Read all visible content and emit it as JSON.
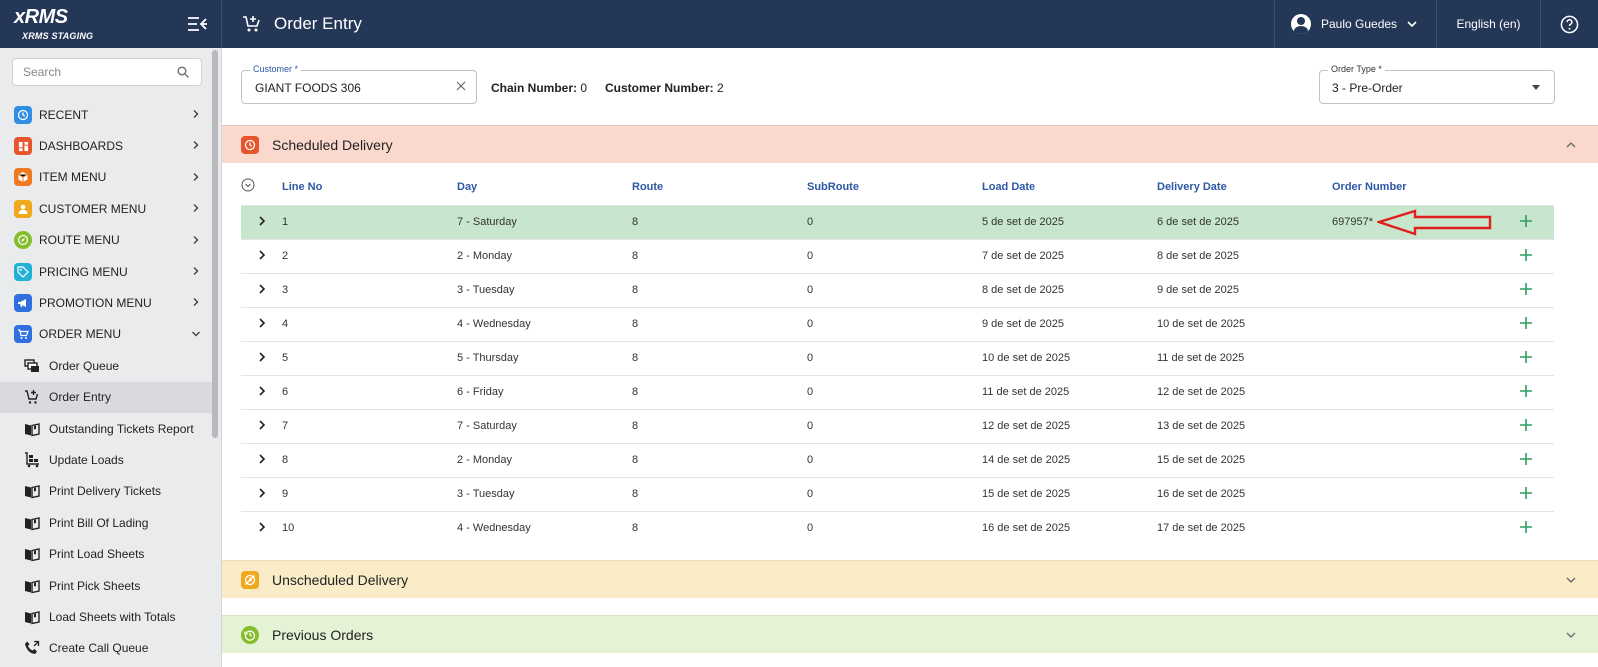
{
  "app": {
    "logo": "xRMS",
    "env": "XRMS STAGING",
    "page_title": "Order Entry",
    "user_name": "Paulo Guedes",
    "language": "English (en)"
  },
  "sidebar": {
    "search_placeholder": "Search",
    "menu": [
      {
        "label": "RECENT",
        "icon": "clock-icon",
        "color": "#2f8fe5"
      },
      {
        "label": "DASHBOARDS",
        "icon": "dashboard-icon",
        "color": "#e8542c"
      },
      {
        "label": "ITEM MENU",
        "icon": "box-icon",
        "color": "#f07a22"
      },
      {
        "label": "CUSTOMER MENU",
        "icon": "person-icon",
        "color": "#f0a81c"
      },
      {
        "label": "ROUTE MENU",
        "icon": "compass-icon",
        "color": "#86bd2c"
      },
      {
        "label": "PRICING MENU",
        "icon": "tag-icon",
        "color": "#21b2d4"
      },
      {
        "label": "PROMOTION MENU",
        "icon": "megaphone-icon",
        "color": "#2f6fe0"
      },
      {
        "label": "ORDER MENU",
        "icon": "cart-icon",
        "color": "#2f6fe0"
      }
    ],
    "submenu": [
      {
        "label": "Order Queue",
        "icon": "queue-icon"
      },
      {
        "label": "Order Entry",
        "icon": "cart-plus-icon",
        "active": true
      },
      {
        "label": "Outstanding Tickets Report",
        "icon": "book-icon"
      },
      {
        "label": "Update Loads",
        "icon": "load-icon"
      },
      {
        "label": "Print Delivery Tickets",
        "icon": "book-icon"
      },
      {
        "label": "Print Bill Of Lading",
        "icon": "book-icon"
      },
      {
        "label": "Print Load Sheets",
        "icon": "book-icon"
      },
      {
        "label": "Print Pick Sheets",
        "icon": "book-icon"
      },
      {
        "label": "Load Sheets with Totals",
        "icon": "book-icon"
      },
      {
        "label": "Create Call Queue",
        "icon": "phone-icon"
      }
    ]
  },
  "form": {
    "customer_label": "Customer *",
    "customer_value": "GIANT FOODS  306",
    "chain_label": "Chain Number:",
    "chain_value": "0",
    "custnum_label": "Customer Number:",
    "custnum_value": "2",
    "ordertype_label": "Order Type *",
    "ordertype_value": "3 - Pre-Order"
  },
  "sections": {
    "scheduled": "Scheduled Delivery",
    "unscheduled": "Unscheduled Delivery",
    "previous": "Previous Orders"
  },
  "table": {
    "headers": [
      "Line No",
      "Day",
      "Route",
      "SubRoute",
      "Load Date",
      "Delivery Date",
      "Order Number"
    ],
    "rows": [
      {
        "line": "1",
        "day": "7 - Saturday",
        "route": "8",
        "sub": "0",
        "load": "5 de set de 2025",
        "delivery": "6 de set de 2025",
        "order": "697957*"
      },
      {
        "line": "2",
        "day": "2 - Monday",
        "route": "8",
        "sub": "0",
        "load": "7 de set de 2025",
        "delivery": "8 de set de 2025",
        "order": ""
      },
      {
        "line": "3",
        "day": "3 - Tuesday",
        "route": "8",
        "sub": "0",
        "load": "8 de set de 2025",
        "delivery": "9 de set de 2025",
        "order": ""
      },
      {
        "line": "4",
        "day": "4 - Wednesday",
        "route": "8",
        "sub": "0",
        "load": "9 de set de 2025",
        "delivery": "10 de set de 2025",
        "order": ""
      },
      {
        "line": "5",
        "day": "5 - Thursday",
        "route": "8",
        "sub": "0",
        "load": "10 de set de 2025",
        "delivery": "11 de set de 2025",
        "order": ""
      },
      {
        "line": "6",
        "day": "6 - Friday",
        "route": "8",
        "sub": "0",
        "load": "11 de set de 2025",
        "delivery": "12 de set de 2025",
        "order": ""
      },
      {
        "line": "7",
        "day": "7 - Saturday",
        "route": "8",
        "sub": "0",
        "load": "12 de set de 2025",
        "delivery": "13 de set de 2025",
        "order": ""
      },
      {
        "line": "8",
        "day": "2 - Monday",
        "route": "8",
        "sub": "0",
        "load": "14 de set de 2025",
        "delivery": "15 de set de 2025",
        "order": ""
      },
      {
        "line": "9",
        "day": "3 - Tuesday",
        "route": "8",
        "sub": "0",
        "load": "15 de set de 2025",
        "delivery": "16 de set de 2025",
        "order": ""
      },
      {
        "line": "10",
        "day": "4 - Wednesday",
        "route": "8",
        "sub": "0",
        "load": "16 de set de 2025",
        "delivery": "17 de set de 2025",
        "order": ""
      }
    ]
  },
  "colors": {
    "topbar": "#243756",
    "scheduled_bg": "#fad8cd",
    "unscheduled_bg": "#f9ecc7",
    "previous_bg": "#e4f2d5",
    "highlight_row": "#c8e6cd",
    "add_green": "#2e9e5e",
    "arrow_red": "#e0201c"
  }
}
